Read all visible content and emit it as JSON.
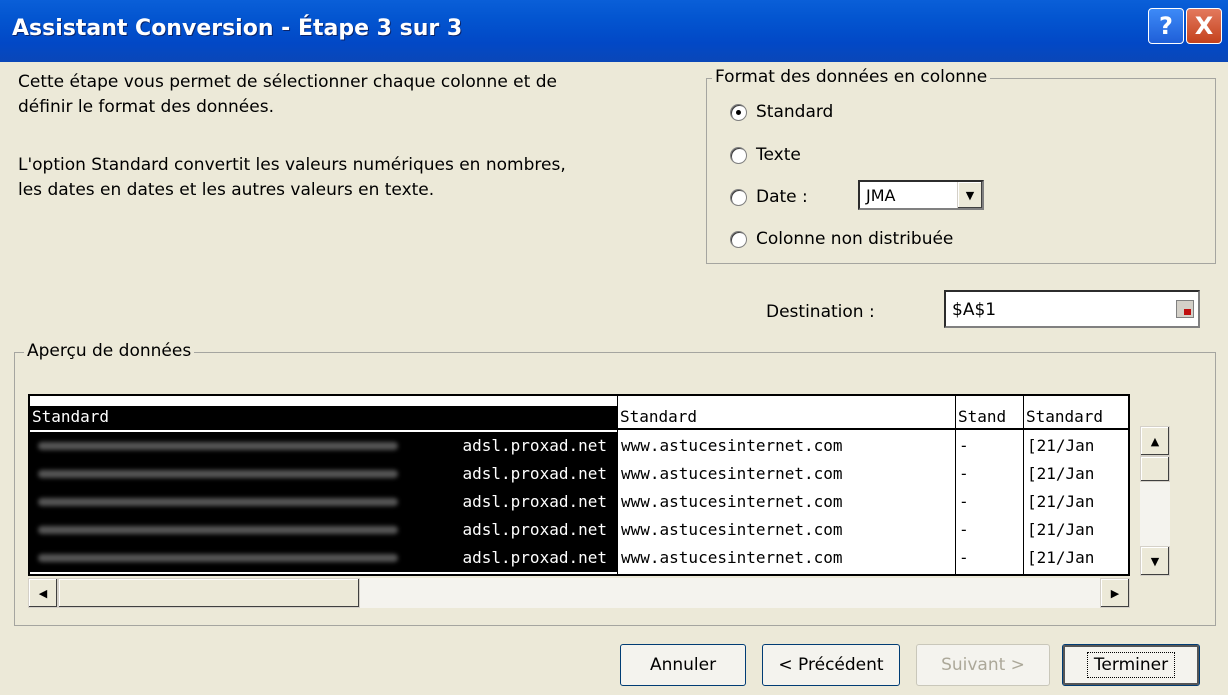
{
  "window": {
    "title": "Assistant Conversion - Étape 3 sur 3",
    "help_label": "?",
    "close_label": "X"
  },
  "description": {
    "line1": "Cette étape vous permet de sélectionner chaque colonne et de",
    "line2": "définir le format des données.",
    "line3": "L'option Standard convertit les valeurs numériques en nombres,",
    "line4": "les dates en dates et les autres valeurs en texte."
  },
  "format": {
    "legend": "Format des données en colonne",
    "options": [
      {
        "label": "Standard",
        "checked": true
      },
      {
        "label": "Texte",
        "checked": false
      },
      {
        "label": "Date :",
        "checked": false
      },
      {
        "label": "Colonne non distribuée",
        "checked": false
      }
    ],
    "date_value": "JMA"
  },
  "destination": {
    "label": "Destination :",
    "value": "$A$1"
  },
  "preview": {
    "legend": "Aperçu de données",
    "columns": [
      {
        "header": "Standard",
        "cells": [
          "adsl.proxad.net",
          "adsl.proxad.net",
          "adsl.proxad.net",
          "adsl.proxad.net",
          "adsl.proxad.net"
        ]
      },
      {
        "header": "Standard",
        "cells": [
          "www.astucesinternet.com",
          "www.astucesinternet.com",
          "www.astucesinternet.com",
          "www.astucesinternet.com",
          "www.astucesinternet.com"
        ]
      },
      {
        "header": "Stand",
        "cells": [
          "-",
          "-",
          "-",
          "-",
          "-"
        ]
      },
      {
        "header": "Standard",
        "cells": [
          "[21/Jan",
          "[21/Jan",
          "[21/Jan",
          "[21/Jan",
          "[21/Jan"
        ]
      }
    ]
  },
  "buttons": {
    "cancel": "Annuler",
    "previous": "< Précédent",
    "next": "Suivant >",
    "finish": "Terminer"
  }
}
